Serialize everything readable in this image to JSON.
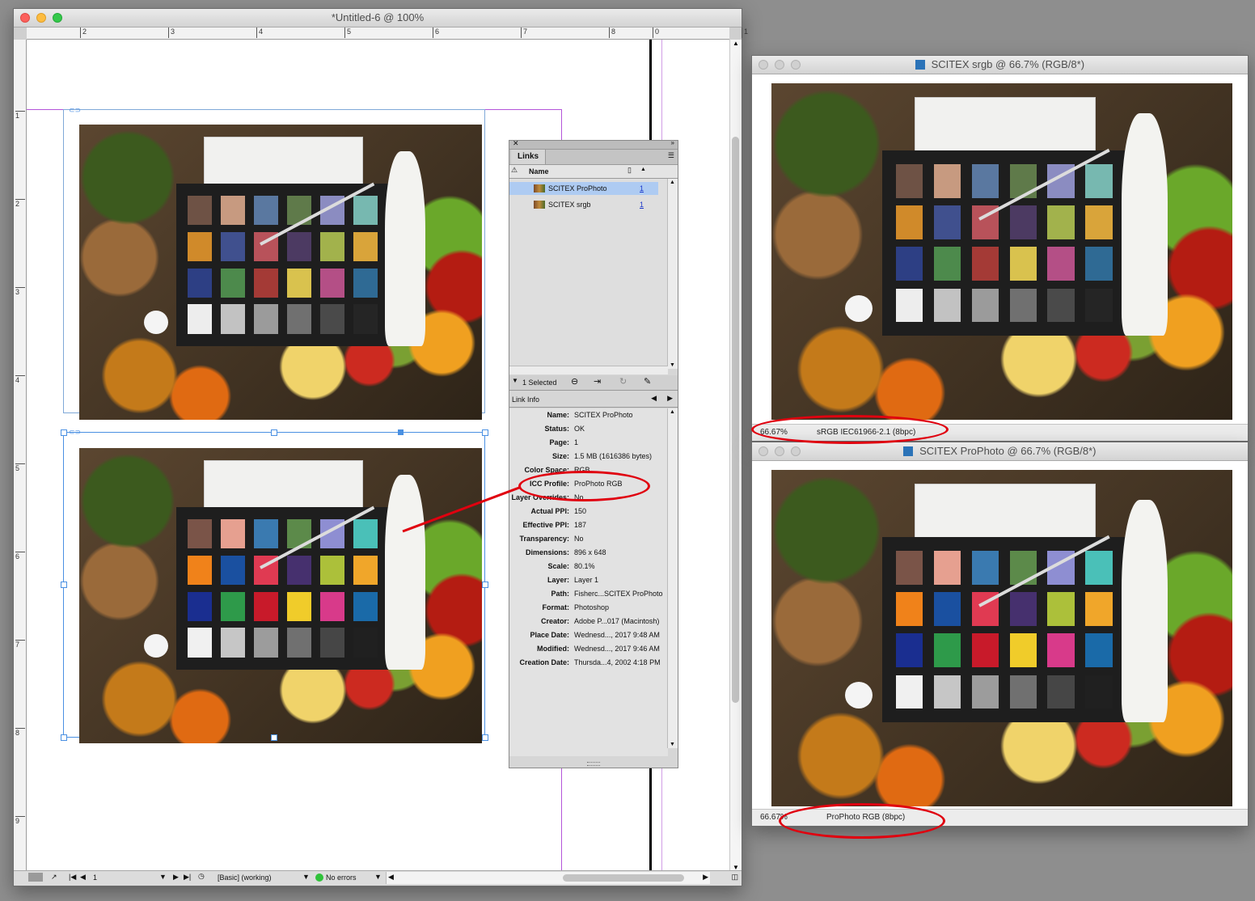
{
  "indesign": {
    "title": "*Untitled-6 @ 100%",
    "ruler_top_labels": [
      "2",
      "3",
      "4",
      "5",
      "6",
      "7",
      "8",
      "0",
      "1"
    ],
    "ruler_left_labels": [
      "1",
      "2",
      "3",
      "4",
      "5",
      "6",
      "7",
      "8",
      "9"
    ],
    "status": {
      "page": "1",
      "preflight_profile": "[Basic] (working)",
      "errors": "No errors"
    }
  },
  "links_panel": {
    "tab_label": "Links",
    "column_name": "Name",
    "items": [
      {
        "name": "SCITEX ProPhoto",
        "page": "1",
        "selected": true
      },
      {
        "name": "SCITEX srgb",
        "page": "1",
        "selected": false
      }
    ],
    "selected_count": "1 Selected",
    "link_info_title": "Link Info",
    "info": [
      {
        "key": "Name:",
        "value": "SCITEX ProPhoto"
      },
      {
        "key": "Status:",
        "value": "OK"
      },
      {
        "key": "Page:",
        "value": "1"
      },
      {
        "key": "Size:",
        "value": "1.5 MB (1616386 bytes)"
      },
      {
        "key": "Color Space:",
        "value": "RGB"
      },
      {
        "key": "ICC Profile:",
        "value": "ProPhoto RGB"
      },
      {
        "key": "Layer Overrides:",
        "value": "No"
      },
      {
        "key": "Actual PPI:",
        "value": "150"
      },
      {
        "key": "Effective PPI:",
        "value": "187"
      },
      {
        "key": "Transparency:",
        "value": "No"
      },
      {
        "key": "Dimensions:",
        "value": "896 x 648"
      },
      {
        "key": "Scale:",
        "value": "80.1%"
      },
      {
        "key": "Layer:",
        "value": "Layer 1"
      },
      {
        "key": "Path:",
        "value": "Fisherc...SCITEX ProPhoto"
      },
      {
        "key": "Format:",
        "value": "Photoshop"
      },
      {
        "key": "Creator:",
        "value": "Adobe P...017 (Macintosh)"
      },
      {
        "key": "Place Date:",
        "value": "Wednesd..., 2017 9:48 AM"
      },
      {
        "key": "Modified:",
        "value": "Wednesd..., 2017 9:46 AM"
      },
      {
        "key": "Creation Date:",
        "value": "Thursda...4, 2002 4:18 PM"
      }
    ]
  },
  "ps_srgb": {
    "title": "SCITEX srgb @ 66.7% (RGB/8*)",
    "zoom": "66.67%",
    "profile": "sRGB IEC61966-2.1 (8bpc)"
  },
  "ps_prophoto": {
    "title": "SCITEX ProPhoto @ 66.7% (RGB/8*)",
    "zoom": "66.67%",
    "profile": "ProPhoto RGB (8bpc)"
  },
  "colors": {
    "annotation": "#e0000f",
    "selection": "#4a90e2",
    "margin_guide": "#b455d9"
  },
  "swatches_srgb": [
    "#6e5245",
    "#c79a80",
    "#5a78a0",
    "#5f7a4a",
    "#8b8cc1",
    "#77b8b0",
    "#d08a2a",
    "#40508e",
    "#b8525a",
    "#4c3a62",
    "#a2b24c",
    "#d9a43a",
    "#2d3f84",
    "#4d8a4c",
    "#a43a36",
    "#d9c24e",
    "#b44f86",
    "#2f6a94",
    "#ededed",
    "#c2c2c2",
    "#9b9b9b",
    "#707070",
    "#4a4a4a",
    "#252525"
  ],
  "swatches_prophoto": [
    "#7a5448",
    "#e6a090",
    "#3a7ab0",
    "#5c8a4a",
    "#8e8ed2",
    "#4ac0b8",
    "#f0821a",
    "#1a50a0",
    "#e03a52",
    "#46306e",
    "#acc03a",
    "#f0a62a",
    "#1a2e90",
    "#2e9a4a",
    "#c81a2a",
    "#f0cc2a",
    "#d83a8a",
    "#1a6aa8",
    "#f0f0f0",
    "#c6c6c6",
    "#9c9c9c",
    "#707070",
    "#464646",
    "#202020"
  ]
}
